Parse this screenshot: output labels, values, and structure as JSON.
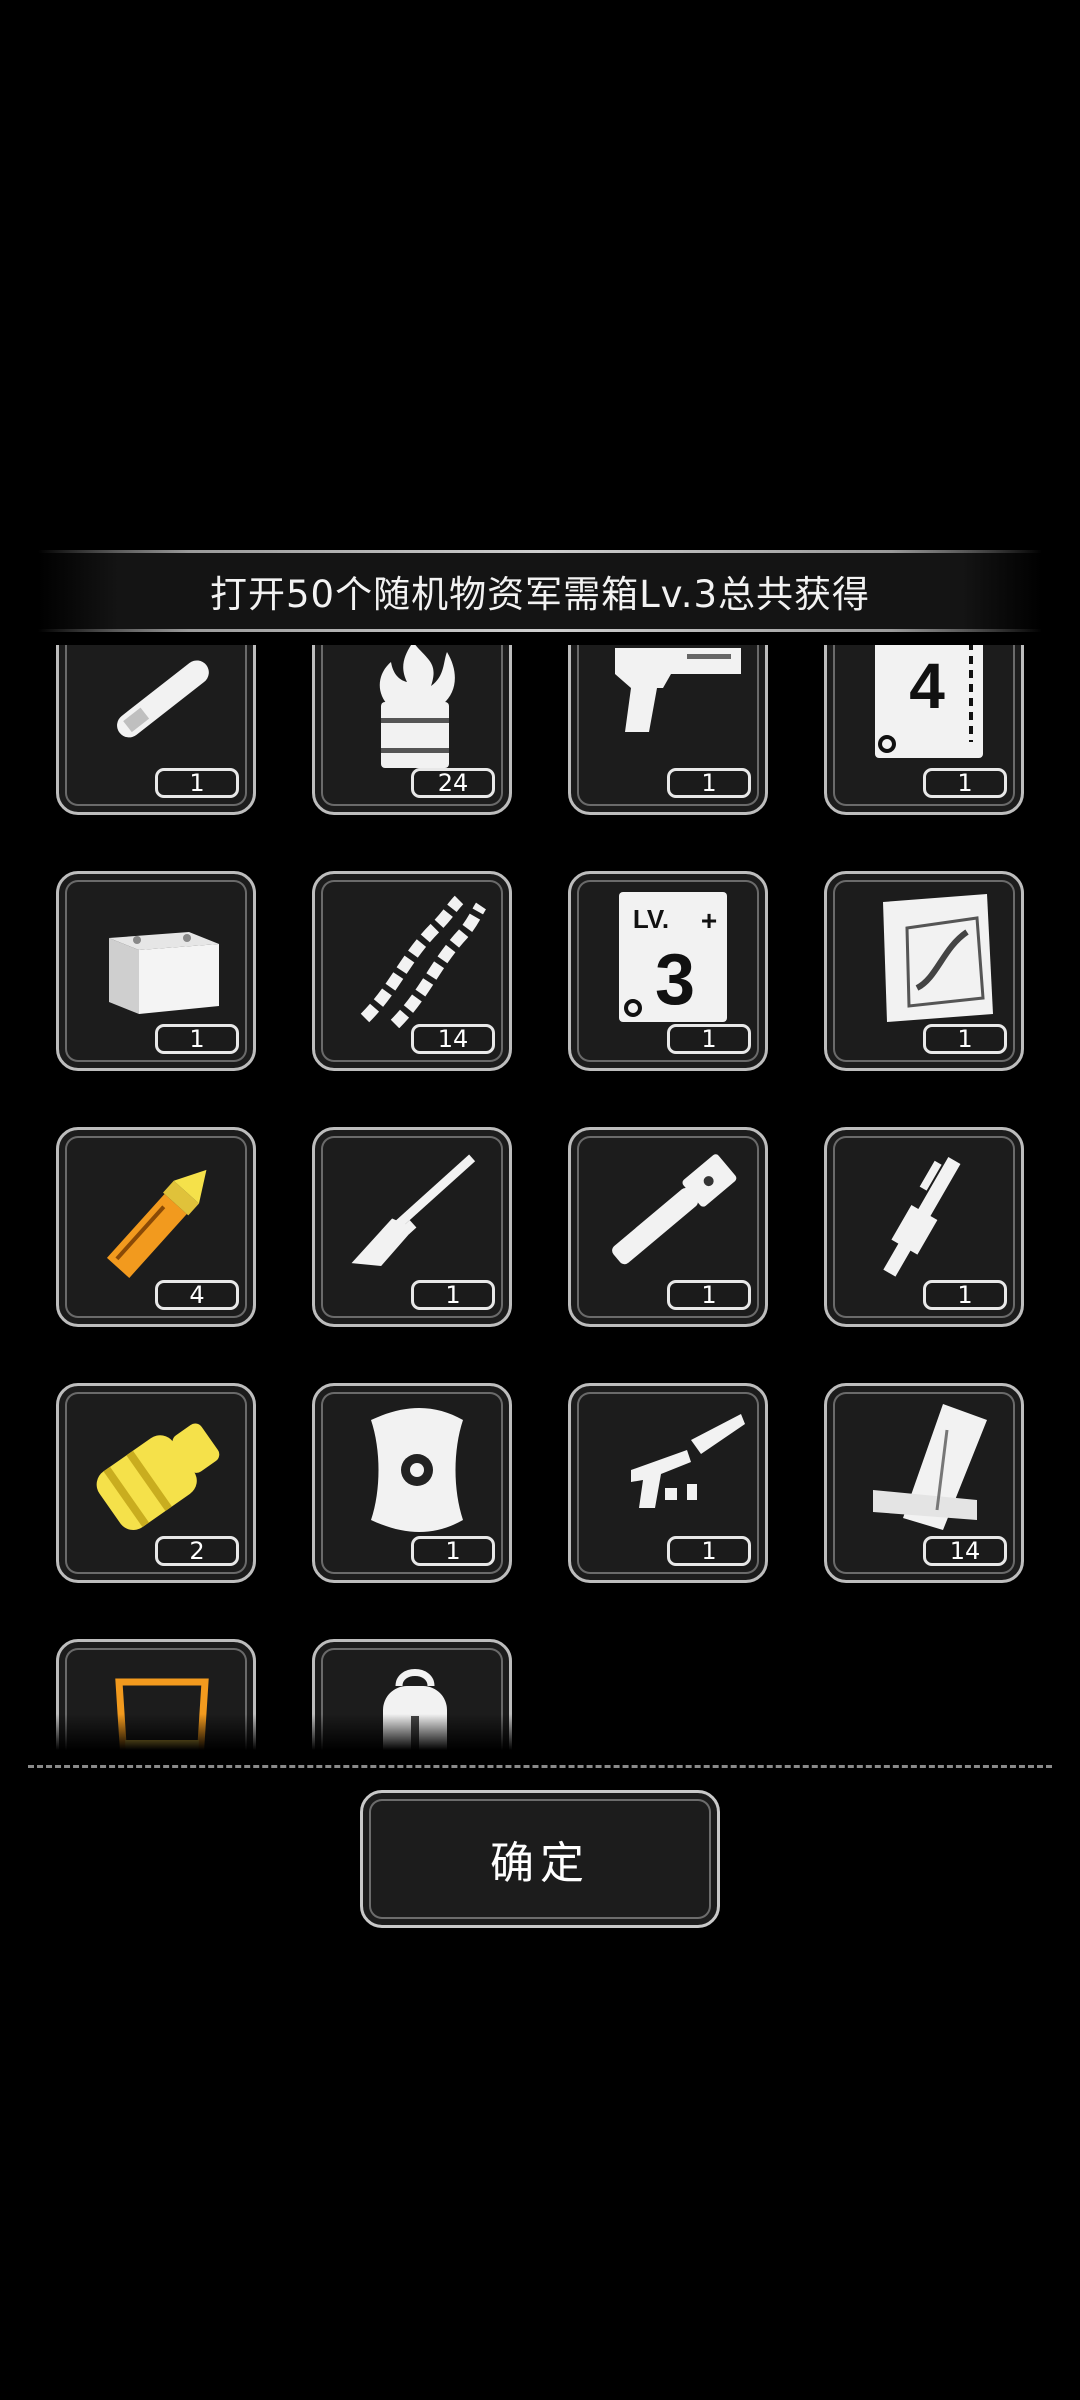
{
  "dialog": {
    "title": "打开50个随机物资军需箱Lv.3总共获得",
    "confirm_label": "确定"
  },
  "items": [
    {
      "icon": "knife-icon",
      "count": "1"
    },
    {
      "icon": "fire-barrel-icon",
      "count": "24"
    },
    {
      "icon": "pistol-icon",
      "count": "1"
    },
    {
      "icon": "level-4-card-icon",
      "count": "1"
    },
    {
      "icon": "battery-icon",
      "count": "1"
    },
    {
      "icon": "wire-coils-icon",
      "count": "14"
    },
    {
      "icon": "level-3-card-icon",
      "count": "1"
    },
    {
      "icon": "blueprint-paper-icon",
      "count": "1"
    },
    {
      "icon": "bullet-icon",
      "count": "4"
    },
    {
      "icon": "rifle-icon",
      "count": "1"
    },
    {
      "icon": "grip-part-icon",
      "count": "1"
    },
    {
      "icon": "trigger-part-icon",
      "count": "1"
    },
    {
      "icon": "gear-part-icon",
      "count": "2"
    },
    {
      "icon": "round-shield-icon",
      "count": "1"
    },
    {
      "icon": "weapon-parts-icon",
      "count": "1"
    },
    {
      "icon": "wood-planks-icon",
      "count": "14"
    },
    {
      "icon": "drink-cup-icon",
      "count": ""
    },
    {
      "icon": "backpack-icon",
      "count": ""
    }
  ],
  "colors": {
    "background": "#000000",
    "tile": "#1c1c1c",
    "border": "#bdbdbd",
    "accent_orange": "#f29a1e",
    "accent_yellow": "#f5e14a"
  }
}
